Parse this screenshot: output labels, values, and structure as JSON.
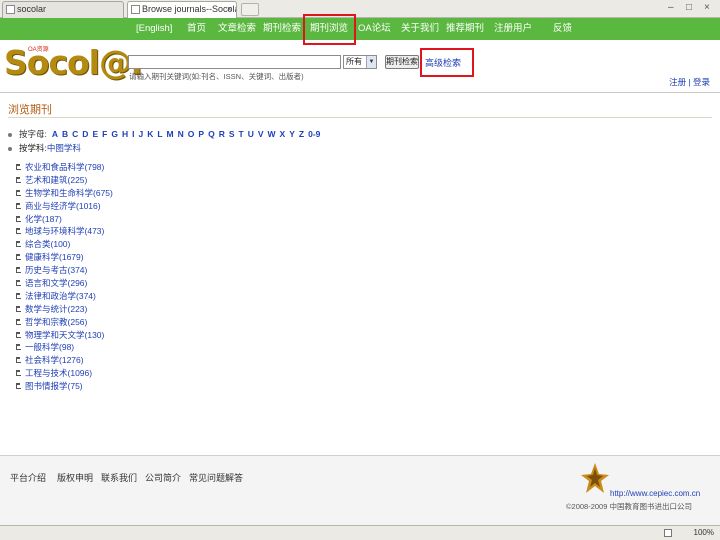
{
  "browser": {
    "tabs": [
      {
        "label": "socolar"
      },
      {
        "label": "Browse journals--Socolar",
        "close": "×"
      }
    ],
    "window_controls": {
      "minimize": "–",
      "maximize": "□",
      "close": "×"
    },
    "zoom": "100%"
  },
  "nav": {
    "items": [
      {
        "label": "[English]"
      },
      {
        "label": "首页"
      },
      {
        "label": "文章检索"
      },
      {
        "label": "期刊检索"
      },
      {
        "label": "期刊浏览",
        "highlighted": true
      },
      {
        "label": "OA论坛"
      },
      {
        "label": "关于我们"
      },
      {
        "label": "推荐期刊"
      },
      {
        "label": "注册用户"
      },
      {
        "label": "反馈"
      }
    ]
  },
  "header": {
    "logo_text": "Socol@r",
    "logo_tagline": "OA资源",
    "search_placeholder": "",
    "scope_value": "所有",
    "search_button": "期刊检索",
    "advanced_search": "高级检索",
    "search_hint": "请输入期刊关键词(如:刊名、ISSN、关键词、出版者)",
    "login_links": "注册 | 登录"
  },
  "section": {
    "title": "浏览期刊"
  },
  "browse": {
    "by_letter_label": "按字母:",
    "letters": [
      "A",
      "B",
      "C",
      "D",
      "E",
      "F",
      "G",
      "H",
      "I",
      "J",
      "K",
      "L",
      "M",
      "N",
      "O",
      "P",
      "Q",
      "R",
      "S",
      "T",
      "U",
      "V",
      "W",
      "X",
      "Y",
      "Z",
      "0-9"
    ],
    "by_category_label": "按学科:",
    "current_category": "中图学科"
  },
  "subjects": [
    {
      "name": "农业和食品科学",
      "count": "(798)"
    },
    {
      "name": "艺术和建筑",
      "count": "(225)"
    },
    {
      "name": "生物学和生命科学",
      "count": "(675)"
    },
    {
      "name": "商业与经济学",
      "count": "(1016)"
    },
    {
      "name": "化学",
      "count": "(187)"
    },
    {
      "name": "地球与环境科学",
      "count": "(473)"
    },
    {
      "name": "综合类",
      "count": "(100)"
    },
    {
      "name": "健康科学",
      "count": "(1679)"
    },
    {
      "name": "历史与考古",
      "count": "(374)"
    },
    {
      "name": "语言和文学",
      "count": "(296)"
    },
    {
      "name": "法律和政治学",
      "count": "(374)"
    },
    {
      "name": "数学与统计",
      "count": "(223)"
    },
    {
      "name": "哲学和宗教",
      "count": "(256)"
    },
    {
      "name": "物理学和天文学",
      "count": "(130)"
    },
    {
      "name": "一般科学",
      "count": "(98)"
    },
    {
      "name": "社会科学",
      "count": "(1276)"
    },
    {
      "name": "工程与技术",
      "count": "(1096)"
    },
    {
      "name": "图书情报学",
      "count": "(75)"
    }
  ],
  "footer": {
    "links": [
      {
        "label": "平台介绍"
      },
      {
        "label": "版权申明"
      },
      {
        "label": "联系我们"
      },
      {
        "label": "公司简介"
      },
      {
        "label": "常见问题解答"
      }
    ],
    "url": "http://www.cepiec.com.cn",
    "copyright": "©2008-2009 中国教育图书进出口公司"
  }
}
